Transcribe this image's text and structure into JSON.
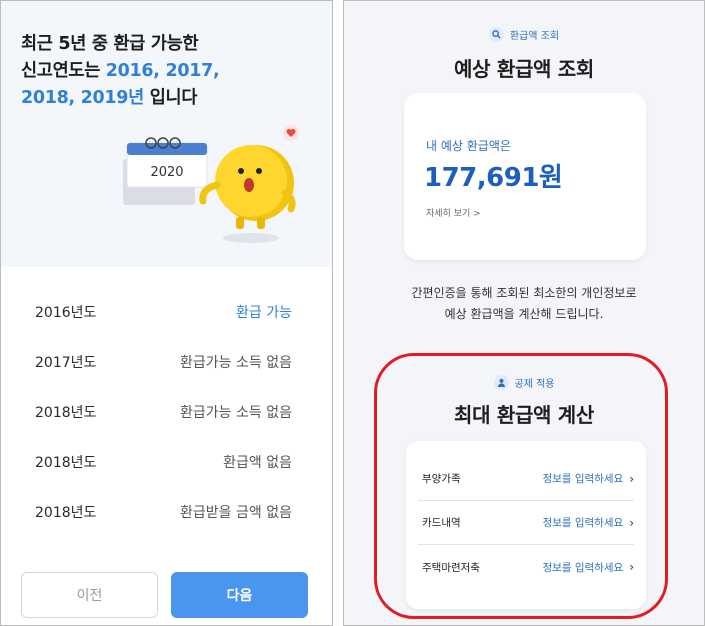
{
  "left": {
    "title_line1": "최근 5년 중 환급 가능한",
    "title_line2_prefix": "신고연도는 ",
    "title_line2_years": "2016, 2017,",
    "title_line3_years": "2018, 2019년",
    "title_line3_suffix": " 입니다",
    "calendar_year": "2020",
    "years": [
      {
        "year": "2016년도",
        "status": "환급 가능"
      },
      {
        "year": "2017년도",
        "status": "환급가능 소득 없음"
      },
      {
        "year": "2018년도",
        "status": "환급가능 소득 없음"
      },
      {
        "year": "2018년도",
        "status": "환급액 없음"
      },
      {
        "year": "2018년도",
        "status": "환급받을 금액 없음"
      }
    ],
    "prev_label": "이전",
    "next_label": "다음"
  },
  "right": {
    "tag1": "환급액 조회",
    "title1": "예상 환급액 조회",
    "refund_label": "내 예상 환급액은",
    "refund_amount": "177,691원",
    "detail_link": "자세히 보기 >",
    "desc_line1": "간편인증을 통해 조회된 최소한의 개인정보로",
    "desc_line2": "예상 환급액을 계산해 드립니다.",
    "tag2": "공제 적용",
    "title2": "최대 환급액 계산",
    "rows": [
      {
        "label": "부양가족",
        "action": "정보를 입력하세요"
      },
      {
        "label": "카드내역",
        "action": "정보를 입력하세요"
      },
      {
        "label": "주택마련저축",
        "action": "정보를 입력하세요"
      }
    ]
  },
  "colors": {
    "accent_blue": "#2f80d6",
    "button_blue": "#4a96ee",
    "highlight_red": "#e41b23"
  }
}
